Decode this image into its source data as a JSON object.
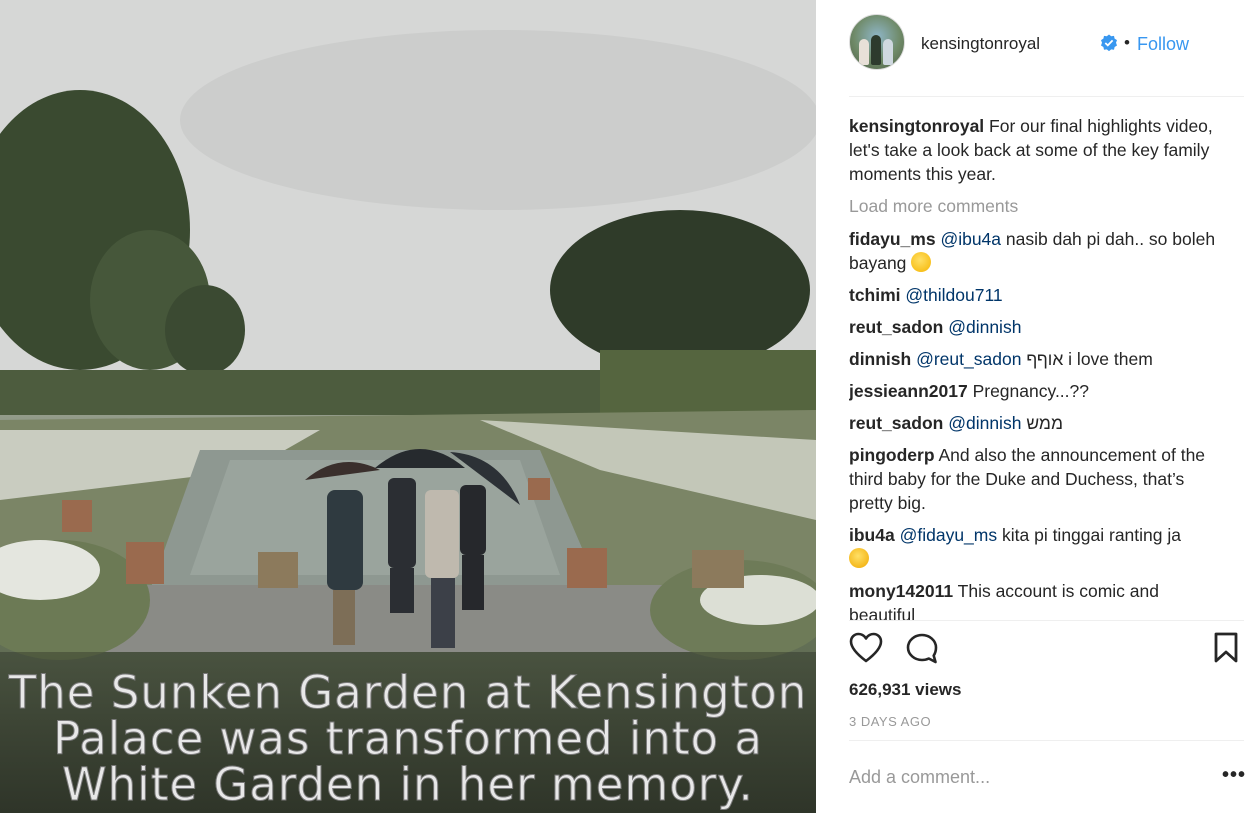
{
  "post": {
    "username": "kensingtonroyal",
    "follow_label": "Follow",
    "separator": "•",
    "caption": "For our final highlights video, let's take a look back at some of the key family moments this year.",
    "load_more": "Load more comments",
    "views": "626,931 views",
    "time_ago": "3 DAYS AGO",
    "add_comment_placeholder": "Add a comment...",
    "more_options": "•••"
  },
  "video": {
    "caption_lines": [
      "The Sunken Garden at Kensington",
      "Palace was transformed into a",
      "White Garden in her memory."
    ]
  },
  "comments": [
    {
      "user": "fidayu_ms",
      "mention": "@ibu4a",
      "text": " nasib dah pi dah.. so boleh bayang",
      "emoji": "grinning-face"
    },
    {
      "user": "tchimi",
      "mention": "@thildou711",
      "text": ""
    },
    {
      "user": "reut_sadon",
      "mention": "@dinnish",
      "text": ""
    },
    {
      "user": "dinnish",
      "mention": "@reut_sadon",
      "text": " אוףף i love them"
    },
    {
      "user": "jessieann2017",
      "mention": "",
      "text": "Pregnancy...??"
    },
    {
      "user": "reut_sadon",
      "mention": "@dinnish",
      "text": " ממש"
    },
    {
      "user": "pingoderp",
      "mention": "",
      "text": "And also the announcement of the third baby for the Duke and Duchess, that’s pretty big."
    },
    {
      "user": "ibu4a",
      "mention": "@fidayu_ms",
      "text": " kita pi tinggai ranting ja",
      "emoji": "sweat-smile-face"
    },
    {
      "user": "mony142011",
      "mention": "",
      "text": " This account is comic and beautiful"
    }
  ],
  "colors": {
    "link": "#3897f0",
    "mention": "#003569",
    "muted": "#999999",
    "text": "#262626"
  },
  "icons": [
    "heart-icon",
    "comment-icon",
    "bookmark-icon",
    "verified-badge-icon"
  ]
}
